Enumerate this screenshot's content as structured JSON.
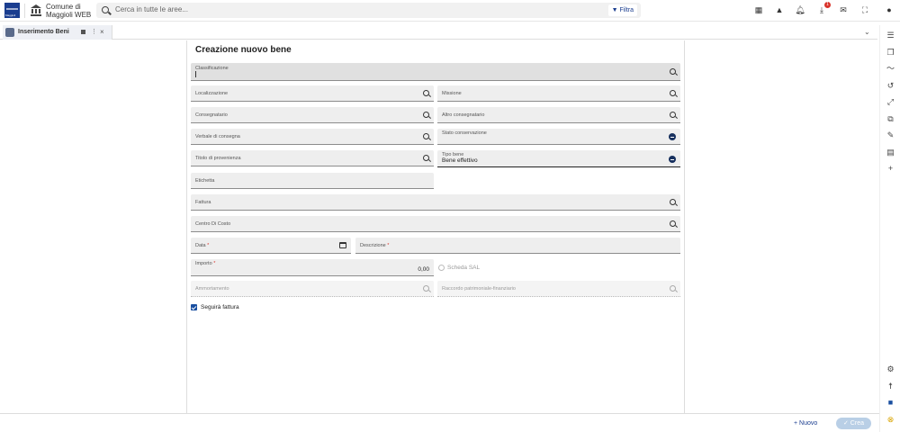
{
  "header": {
    "logo_text": "Maggioli",
    "app_name": "Comune di Maggioli WEB",
    "search_placeholder": "Cerca in tutte le aree...",
    "filter_label": "Filtra",
    "notification_count": "1"
  },
  "tab": {
    "label": "Inserimento Beni"
  },
  "form": {
    "title": "Creazione nuovo bene",
    "classificazione": "Classificazione",
    "localizzazione": "Localizzazione",
    "missione": "Missione",
    "consegnatario": "Consegnatario",
    "altro_consegnatario": "Altro consegnatario",
    "verbale": "Verbale di consegna",
    "stato_conservazione": "Stato conservazione",
    "titolo_provenienza": "Titolo di provenienza",
    "tipo_bene_label": "Tipo bene",
    "tipo_bene_value": "Bene effettivo",
    "etichetta": "Etichetta",
    "fattura": "Fattura",
    "centro_costo": "Centro Di Costo",
    "data": "Data",
    "descrizione": "Descrizione",
    "importo": "Importo",
    "importo_value": "0,00",
    "scheda_sal": "Scheda SAL",
    "ammortamento": "Ammortamento",
    "raccordo": "Raccordo patrimoniale-finanziario",
    "seguira_fattura": "Seguirà fattura",
    "required_mark": "*"
  },
  "footer": {
    "nuovo": "+ Nuovo",
    "crea": "✓ Crea"
  },
  "colors": {
    "accent": "#1a3d8f",
    "required": "#d9342b",
    "dropdown": "#17305e"
  }
}
